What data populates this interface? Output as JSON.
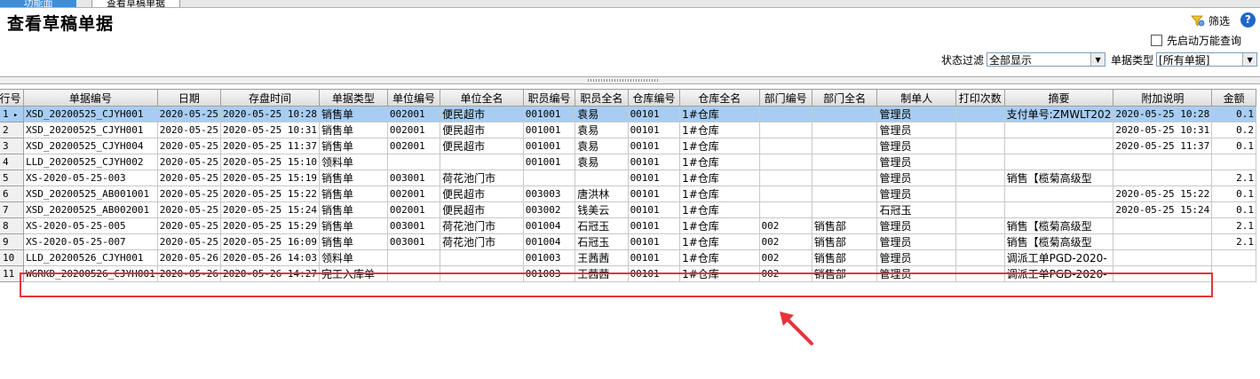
{
  "tabs": [
    {
      "label": "功能面"
    },
    {
      "label": "查看草稿单据"
    }
  ],
  "page": {
    "title": "查看草稿单据"
  },
  "toolbar": {
    "filter_label": "筛选",
    "filter_icon": "filter-icon",
    "help_icon": "help-icon",
    "auto_query_label": "先启动万能查询",
    "auto_query_checked": false
  },
  "filters": {
    "status_label": "状态过滤",
    "status_value": "全部显示",
    "doc_type_label": "单据类型",
    "doc_type_value": "[所有单据]"
  },
  "colors": {
    "selected_row": "#a8cdf2",
    "highlight_box": "#e8333a",
    "arrow": "#e8333a"
  },
  "grid": {
    "columns": [
      "行号",
      "单据编号",
      "日期",
      "存盘时间",
      "单据类型",
      "单位编号",
      "单位全名",
      "职员编号",
      "职员全名",
      "仓库编号",
      "仓库全名",
      "部门编号",
      "部门全名",
      "制单人",
      "打印次数",
      "摘要",
      "附加说明",
      "金额"
    ],
    "rows": [
      [
        "1",
        "XSD_20200525_CJYH001",
        "2020-05-25",
        "2020-05-25 10:28",
        "销售单",
        "002001",
        "便民超市",
        "001001",
        "袁易",
        "00101",
        "1#仓库",
        "",
        "",
        "管理员",
        "",
        "支付单号:ZMWLT202",
        "2020-05-25 10:28",
        "0.1"
      ],
      [
        "2",
        "XSD_20200525_CJYH001",
        "2020-05-25",
        "2020-05-25 10:31",
        "销售单",
        "002001",
        "便民超市",
        "001001",
        "袁易",
        "00101",
        "1#仓库",
        "",
        "",
        "管理员",
        "",
        "",
        "2020-05-25 10:31",
        "0.2"
      ],
      [
        "3",
        "XSD_20200525_CJYH004",
        "2020-05-25",
        "2020-05-25 11:37",
        "销售单",
        "002001",
        "便民超市",
        "001001",
        "袁易",
        "00101",
        "1#仓库",
        "",
        "",
        "管理员",
        "",
        "",
        "2020-05-25 11:37",
        "0.1"
      ],
      [
        "4",
        "LLD_20200525_CJYH002",
        "2020-05-25",
        "2020-05-25 15:10",
        "领料单",
        "",
        "",
        "001001",
        "袁易",
        "00101",
        "1#仓库",
        "",
        "",
        "管理员",
        "",
        "",
        "",
        ""
      ],
      [
        "5",
        "XS-2020-05-25-003",
        "2020-05-25",
        "2020-05-25 15:19",
        "销售单",
        "003001",
        "荷花池门市",
        "",
        "",
        "00101",
        "1#仓库",
        "",
        "",
        "管理员",
        "",
        "销售【榄菊高级型",
        "",
        "2.1"
      ],
      [
        "6",
        "XSD_20200525_AB001001",
        "2020-05-25",
        "2020-05-25 15:22",
        "销售单",
        "002001",
        "便民超市",
        "003003",
        "唐洪林",
        "00101",
        "1#仓库",
        "",
        "",
        "管理员",
        "",
        "",
        "2020-05-25 15:22",
        "0.1"
      ],
      [
        "7",
        "XSD_20200525_AB002001",
        "2020-05-25",
        "2020-05-25 15:24",
        "销售单",
        "002001",
        "便民超市",
        "003002",
        "钱美云",
        "00101",
        "1#仓库",
        "",
        "",
        "石冠玉",
        "",
        "",
        "2020-05-25 15:24",
        "0.1"
      ],
      [
        "8",
        "XS-2020-05-25-005",
        "2020-05-25",
        "2020-05-25 15:29",
        "销售单",
        "003001",
        "荷花池门市",
        "001004",
        "石冠玉",
        "00101",
        "1#仓库",
        "002",
        "销售部",
        "管理员",
        "",
        "销售【榄菊高级型",
        "",
        "2.1"
      ],
      [
        "9",
        "XS-2020-05-25-007",
        "2020-05-25",
        "2020-05-25 16:09",
        "销售单",
        "003001",
        "荷花池门市",
        "001004",
        "石冠玉",
        "00101",
        "1#仓库",
        "002",
        "销售部",
        "管理员",
        "",
        "销售【榄菊高级型",
        "",
        "2.1"
      ],
      [
        "10",
        "LLD_20200526_CJYH001",
        "2020-05-26",
        "2020-05-26 14:03",
        "领料单",
        "",
        "",
        "001003",
        "王茜茜",
        "00101",
        "1#仓库",
        "002",
        "销售部",
        "管理员",
        "",
        "调派工单PGD-2020-",
        "",
        ""
      ],
      [
        "11",
        "WGRKD_20200526_CJYH001",
        "2020-05-26",
        "2020-05-26 14:27",
        "完工入库单",
        "",
        "",
        "001003",
        "王茜茜",
        "00101",
        "1#仓库",
        "002",
        "销售部",
        "管理员",
        "",
        "调派工单PGD-2020-",
        "",
        ""
      ]
    ]
  }
}
